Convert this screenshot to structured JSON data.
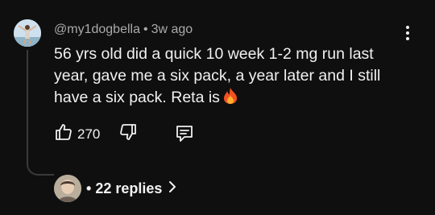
{
  "comment": {
    "author": "@my1dogbella",
    "separator": "•",
    "age": "3w ago",
    "text": "56 yrs old did a quick 10 week 1-2 mg run last year, gave me a six pack, a year later and I still have a six pack.  Reta is",
    "emoji_icon": "fire-emoji",
    "like_count": "270"
  },
  "actions": {
    "like_icon": "thumbs-up-icon",
    "dislike_icon": "thumbs-down-icon",
    "reply_icon": "comment-reply-icon",
    "menu_icon": "vertical-ellipsis-icon"
  },
  "replies": {
    "bullet": "•",
    "label": "22 replies",
    "chevron_icon": "chevron-right-icon"
  },
  "colors": {
    "background": "#0f0f0f",
    "text": "#f1f1f1",
    "secondary_text": "#aaaaaa",
    "thread_line": "#3a3a3a"
  }
}
